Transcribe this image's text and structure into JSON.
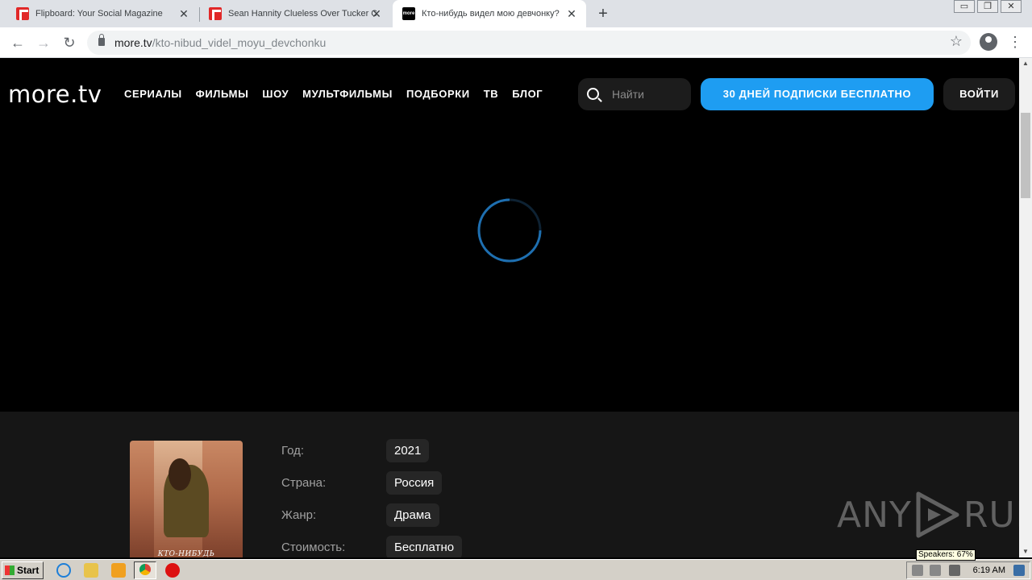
{
  "browser": {
    "tabs": [
      {
        "title": "Flipboard: Your Social Magazine",
        "close": "✕"
      },
      {
        "title": "Sean Hannity Clueless Over Tucker C",
        "close": "✕"
      },
      {
        "title": "Кто-нибудь видел мою девчонку? ",
        "close": "✕"
      }
    ],
    "new_tab": "+",
    "url_host": "more.tv",
    "url_path": "/kto-nibud_videl_moyu_devchonku",
    "window_controls": [
      "▭",
      "❐",
      "✕"
    ]
  },
  "site": {
    "logo": "more.tv",
    "nav": [
      "СЕРИАЛЫ",
      "ФИЛЬМЫ",
      "ШОУ",
      "МУЛЬТФИЛЬМЫ",
      "ПОДБОРКИ",
      "ТВ",
      "БЛОГ"
    ],
    "search_placeholder": "Найти",
    "promo_button": "30 ДНЕЙ ПОДПИСКИ БЕСПЛАТНО",
    "login_button": "ВОЙТИ"
  },
  "details": {
    "poster_title": "КТО-НИБУДЬ",
    "rows": [
      {
        "label": "Год:",
        "value": "2021"
      },
      {
        "label": "Страна:",
        "value": "Россия"
      },
      {
        "label": "Жанр:",
        "value": "Драма"
      },
      {
        "label": "Стоимость:",
        "value": "Бесплатно"
      }
    ]
  },
  "watermark": {
    "left": "ANY",
    "right": "RUN"
  },
  "taskbar": {
    "start": "Start",
    "clock": "6:19 AM",
    "tooltip": "Speakers: 67%"
  },
  "colors": {
    "accent": "#1e9df2",
    "spinner": "#1e6fb0"
  }
}
